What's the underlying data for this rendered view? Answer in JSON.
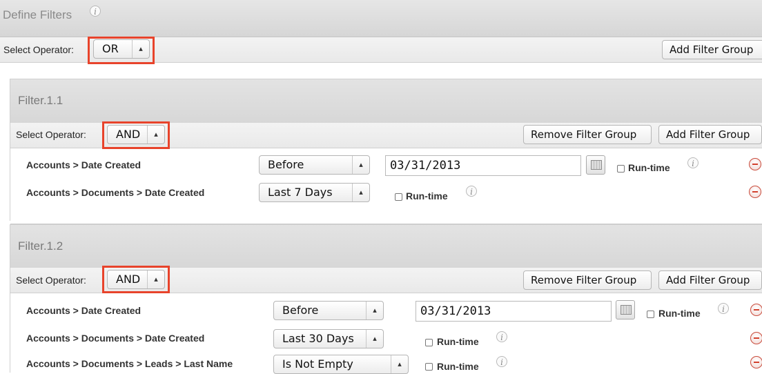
{
  "define": {
    "title": "Define Filters",
    "info_icon": "info-icon"
  },
  "top_bar": {
    "operator_label": "Select Operator:",
    "operator_value": "OR",
    "add_group_label": "Add Filter Group"
  },
  "groups": [
    {
      "title": "Filter.1.1",
      "operator_label": "Select Operator:",
      "operator_value": "AND",
      "remove_group_label": "Remove Filter Group",
      "add_group_label": "Add Filter Group",
      "rows": [
        {
          "field": "Accounts > Date Created",
          "qualifier": "Before",
          "value": "03/31/2013",
          "runtime_label": "Run-time"
        },
        {
          "field": "Accounts > Documents > Date Created",
          "qualifier": "Last 7 Days",
          "runtime_label": "Run-time"
        }
      ]
    },
    {
      "title": "Filter.1.2",
      "operator_label": "Select Operator:",
      "operator_value": "AND",
      "remove_group_label": "Remove Filter Group",
      "add_group_label": "Add Filter Group",
      "rows": [
        {
          "field": "Accounts > Date Created",
          "qualifier": "Before",
          "value": "03/31/2013",
          "runtime_label": "Run-time"
        },
        {
          "field": "Accounts > Documents > Date Created",
          "qualifier": "Last 30 Days",
          "runtime_label": "Run-time"
        },
        {
          "field": "Accounts > Documents > Leads > Last Name",
          "qualifier": "Is Not Empty",
          "runtime_label": "Run-time"
        }
      ]
    }
  ],
  "colors": {
    "highlight": "#e8432b",
    "remove": "#d2402c"
  }
}
